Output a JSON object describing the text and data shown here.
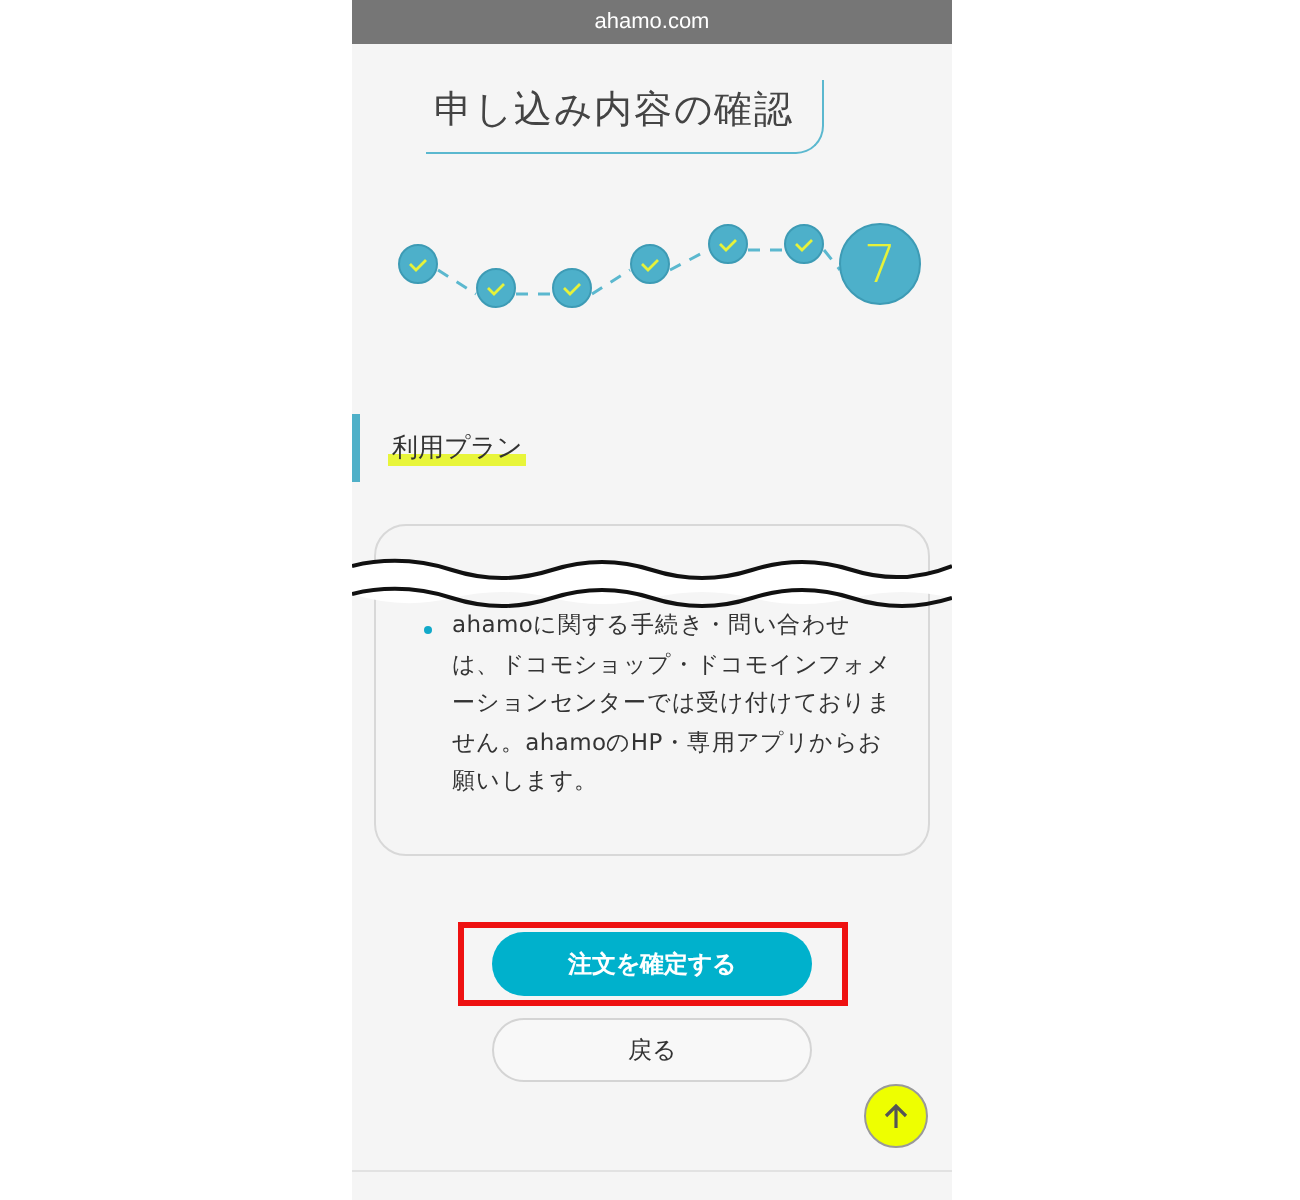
{
  "browser": {
    "url": "ahamo.com"
  },
  "page_title": "申し込み内容の確認",
  "steps": [
    {
      "done": true
    },
    {
      "done": true
    },
    {
      "done": true
    },
    {
      "done": true
    },
    {
      "done": true
    },
    {
      "done": true
    },
    {
      "done": false,
      "label": "7"
    }
  ],
  "section": {
    "title": "利用プラン"
  },
  "card": {
    "notes": [
      "ahamoに関する手続き・問い合わせは、ドコモショップ・ドコモインフォメーションセンターでは受け付けておりません。ahamoのHP・専用アプリからお願いします。"
    ]
  },
  "buttons": [
    {
      "label": "注文を確定する",
      "kind": "primary",
      "highlighted": true
    },
    {
      "label": "戻る",
      "kind": "secondary",
      "highlighted": false
    }
  ]
}
